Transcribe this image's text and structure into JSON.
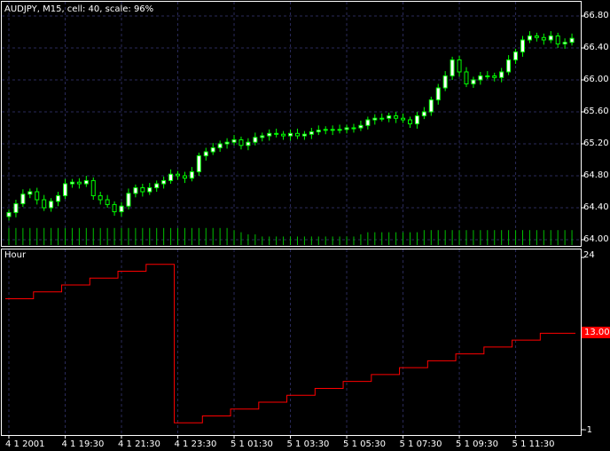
{
  "header": {
    "title": "AUDJPY, M15, cell: 40, scale: 96%"
  },
  "indicator": {
    "title": "Hour",
    "y_top_label": "24",
    "y_bottom_label": "-1",
    "current_value": "13.000"
  },
  "colors": {
    "background": "#000000",
    "grid": "#2a2a5a",
    "candle": "#00ff00",
    "candle_body_up": "#ffffff",
    "volume": "#00c000",
    "indicator_line": "#ff0000",
    "axis": "#ffffff"
  },
  "chart_data": [
    {
      "type": "candlestick",
      "symbol": "AUDJPY",
      "timeframe": "M15",
      "y_ticks": [
        "66.80",
        "66.40",
        "66.00",
        "65.60",
        "65.20",
        "64.80",
        "64.40",
        "64.00"
      ],
      "x_ticks": [
        "4 1 2001",
        "4 1 19:30",
        "4 1 21:30",
        "4 1 23:30",
        "5 1 01:30",
        "5 1 03:30",
        "5 1 05:30",
        "5 1 07:30",
        "5 1 09:30",
        "5 1 11:30"
      ],
      "ylim": [
        64.0,
        66.8
      ],
      "close": [
        64.34,
        64.45,
        64.57,
        64.6,
        64.5,
        64.4,
        64.48,
        64.55,
        64.7,
        64.72,
        64.7,
        64.74,
        64.55,
        64.5,
        64.44,
        64.35,
        64.42,
        64.58,
        64.65,
        64.6,
        64.65,
        64.7,
        64.74,
        64.82,
        64.8,
        64.77,
        64.85,
        65.05,
        65.1,
        65.15,
        65.2,
        65.22,
        65.25,
        65.18,
        65.22,
        65.28,
        65.3,
        65.33,
        65.32,
        65.3,
        65.33,
        65.3,
        65.32,
        65.35,
        65.37,
        65.38,
        65.37,
        65.38,
        65.4,
        65.4,
        65.43,
        65.5,
        65.52,
        65.52,
        65.55,
        65.52,
        65.5,
        65.45,
        65.55,
        65.6,
        65.75,
        65.9,
        66.05,
        66.25,
        66.1,
        65.95,
        66.0,
        66.05,
        66.05,
        66.03,
        66.1,
        66.25,
        66.35,
        66.5,
        66.55,
        66.53,
        66.5,
        66.55,
        66.45,
        66.47,
        66.52
      ],
      "volume": [
        8,
        8,
        8,
        8,
        8,
        8,
        8,
        8,
        8,
        8,
        8,
        8,
        8,
        8,
        8,
        8,
        8,
        8,
        8,
        8,
        8,
        8,
        8,
        8,
        8,
        8,
        8,
        8,
        8,
        8,
        8,
        8,
        7,
        6,
        5,
        5,
        4,
        4,
        4,
        4,
        4,
        4,
        4,
        4,
        4,
        4,
        4,
        4,
        4,
        4,
        5,
        6,
        6,
        6,
        6,
        6,
        6,
        6,
        6,
        7,
        7,
        7,
        7,
        7,
        7,
        7,
        7,
        7,
        7,
        7,
        7,
        7,
        7,
        7,
        7,
        7,
        7,
        7,
        7,
        7,
        7
      ]
    },
    {
      "type": "line",
      "name": "Hour",
      "y_ticks": [
        "24",
        "-1"
      ],
      "ylim": [
        -1,
        24
      ],
      "values": [
        18,
        18,
        18,
        18,
        19,
        19,
        19,
        19,
        20,
        20,
        20,
        20,
        21,
        21,
        21,
        21,
        22,
        22,
        22,
        22,
        23,
        23,
        23,
        23,
        0,
        0,
        0,
        0,
        1,
        1,
        1,
        1,
        2,
        2,
        2,
        2,
        3,
        3,
        3,
        3,
        4,
        4,
        4,
        4,
        5,
        5,
        5,
        5,
        6,
        6,
        6,
        6,
        7,
        7,
        7,
        7,
        8,
        8,
        8,
        8,
        9,
        9,
        9,
        9,
        10,
        10,
        10,
        10,
        11,
        11,
        11,
        11,
        12,
        12,
        12,
        12,
        13,
        13,
        13,
        13,
        13
      ]
    }
  ]
}
